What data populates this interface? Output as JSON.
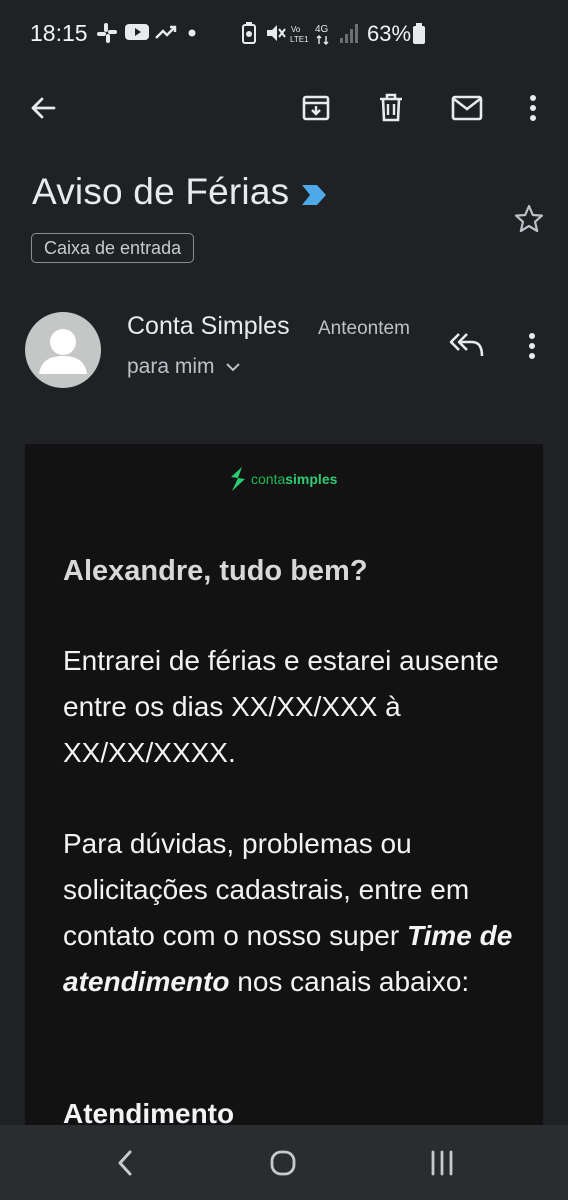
{
  "status_bar": {
    "time": "18:15",
    "battery_percent": "63%"
  },
  "email": {
    "subject": "Aviso de Férias",
    "label": "Caixa de entrada",
    "sender": "Conta Simples",
    "date": "Anteontem",
    "recipient": "para mim",
    "brand": {
      "light": "conta",
      "bold": "simples"
    },
    "body": {
      "greeting": "Alexandre, tudo bem?",
      "para1": "Entrarei de férias e estarei ausente entre os dias XX/XX/XXX à XX/XX/XXXX.",
      "para2_pre": "Para dúvidas, problemas ou solicitações cadastrais, entre em contato com o nosso super ",
      "para2_emph": "Time de atendimento",
      "para2_post": " nos canais abaixo:",
      "section_heading": "Atendimento"
    }
  },
  "colors": {
    "background": "#1f2125",
    "accent_arrow": "#4fa8e8",
    "brand_green": "#2ecc71"
  }
}
